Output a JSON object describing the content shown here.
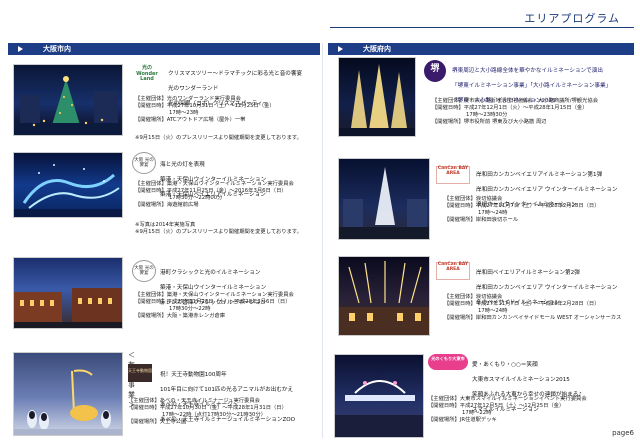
{
  "page": {
    "title": "エリアプログラム",
    "page_number": "page6"
  },
  "left_header": "大阪市内",
  "right_header": "大阪府内",
  "entries": {
    "e1": {
      "logo_text": "光のWonder Land",
      "lines": [
        "クリスマスツリー〜ドラマチックに彩る光と音の饗宴",
        "光のワンダーランド",
        "光の回廊（コボ）クリスマスパーティー"
      ],
      "info": [
        "【主催団体】光のワンダーランド実行委員会",
        "【開催日時】平成27年10月31日（土）〜12月25日（金）",
        "17時〜23時",
        "【開催場所】ATCアウトドア広場（屋外）一帯"
      ],
      "note": "※9月15日（火）のプレスリリースより開催期間を変更しております。"
    },
    "e2": {
      "logo_text": "大阪 光の饗宴",
      "lines": [
        "海と光の灯を表現",
        "築港・天保山ウインターイルミネーション",
        "築港・天保山ベイエリアイルミネーション"
      ],
      "info": [
        "【主催団体】築港・天保山ウインターイルミネーション実行委員会",
        "【開催日時】平成27年11月25日（金）〜2016年3月6日（日）",
        "17時30分〜22時00分",
        "【開催場所】海遊館前広場"
      ],
      "note": "※写真は2014年実施写真\n※9月15日（火）のプレスリリースより開催期間を変更しております。"
    },
    "e3": {
      "logo_text": "大阪 光の饗宴",
      "lines": [
        "港町クラシックと光のイルミネーション",
        "築港・天保山ウインターイルミネーション",
        "赤レンガ倉庫クラシックイルミネーション"
      ],
      "info": [
        "【主催団体】築港・天保山ウインターイルミネーション実行委員会",
        "【開催日時】平成27年11月28日（土）〜平成28年3月6日（日）",
        "17時30分〜22時",
        "【開催場所】大阪・築港赤レンガ倉庫"
      ]
    },
    "e4": {
      "paid_label": "＜有料事業＞",
      "logo_text": "天王寺動物園",
      "lines": [
        "祝！天王寺動物園100周年",
        "101年目に向けて101匹の光るアニマルがお出むかえ",
        "あべの・天王寺イルミナージュ",
        "あべの・天王寺イルミナージュイルミネーションZOO"
      ],
      "info": [
        "【主催団体】あべの・天王寺イルミナージュ実行委員会",
        "【開催日時】平成27年10月30日（金）〜平成28年1月31日（日）",
        "17時〜22時（点灯17時30分〜21時30分）",
        "【開催場所】天王寺公園"
      ]
    },
    "e5": {
      "logo_text": "堺",
      "lines": [
        "堺東周辺と大小路線全体を華やかなイルミネーションで演出",
        "「堺東イルミネーション事業」「大小路イルミネーション事業」",
        "「堺東・大小路」イルミネーション2015"
      ],
      "info": [
        "【主催団体】堺市中心市街地活性化協議会・大小路商議所/堺観光協会",
        "【開催日時】平成27年12月1日（火）〜平成28年1月15日（金）",
        "17時〜23時30分",
        "【開催場所】堺市役所前 堺東及び大小路筋 周辺"
      ]
    },
    "e6": {
      "logo_text": "CanCan BAY AREA",
      "lines": [
        "岸和田カンカンベイエリアイルミネーション第1弾",
        "岸和田カンカンベイエリア ウインターイルミネーション",
        "浪切ホールウインターイルミネーション"
      ],
      "info": [
        "【主催団体】浪切協議会",
        "【開催日時】平成27年11月7日（土）〜平成28年2月28日（日）",
        "17時〜24時",
        "【開催場所】岸和田浪切ホール"
      ]
    },
    "e7": {
      "logo_text": "CanCan BAY AREA",
      "lines": [
        "岸和田ベイエリアイルミネーション第2弾",
        "岸和田カンカンベイエリア ウインターイルミネーション",
        "冬のベイサイドイルミネーション"
      ],
      "info": [
        "【主催団体】浪切協議会",
        "【開催日時】平成27年11月7日（土）〜平成28年2月28日（日）",
        "17時〜24時",
        "【開催場所】岸和田カンカンベイサイドモール WEST オーシャンサーカス"
      ]
    },
    "e8": {
      "logo_text": "光のくもり大東市",
      "lines": [
        "愛・あくもり・○○＝笑顔",
        "大東市スマイルイルミネーション2015",
        "笑顔あふれる大東から幸せの連鎖が始まる♪",
        "スマイルイルミネーション"
      ],
      "info": [
        "【主催団体】大東市スマイルイルミネーションイベント実行委員会",
        "【開催日時】平成27年12月5日（土）〜12月25日（金）",
        "17時〜22時",
        "【開催場所】JR住道駅デッキ"
      ]
    }
  }
}
